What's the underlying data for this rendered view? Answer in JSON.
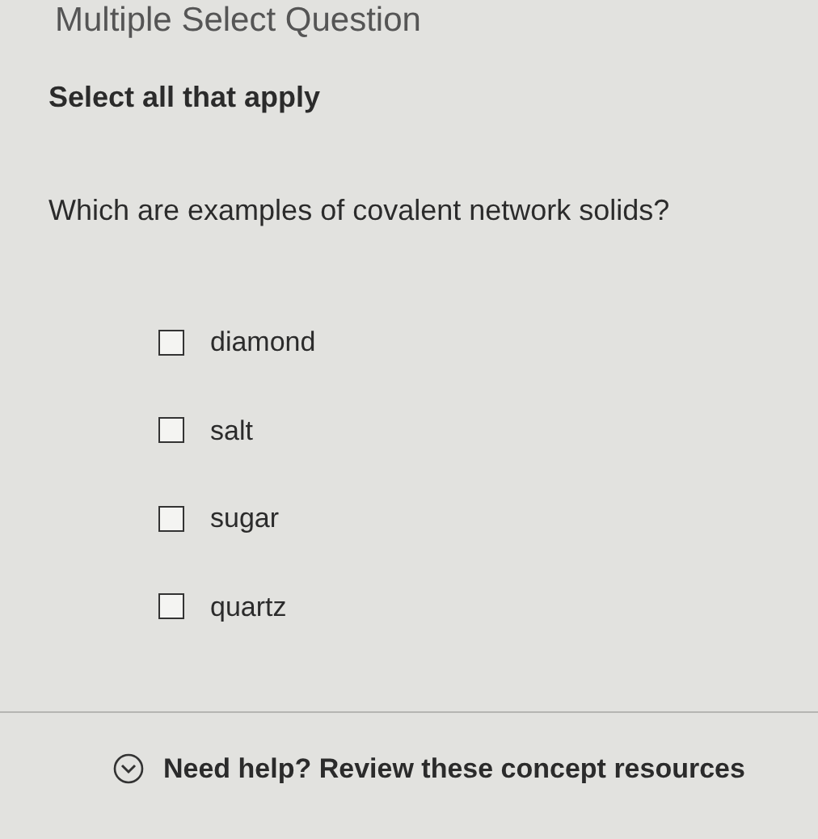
{
  "header": {
    "title": "Multiple Select Question"
  },
  "instruction": "Select all that apply",
  "question": "Which are examples of covalent network solids?",
  "options": [
    {
      "label": "diamond",
      "checked": false
    },
    {
      "label": "salt",
      "checked": false
    },
    {
      "label": "sugar",
      "checked": false
    },
    {
      "label": "quartz",
      "checked": false
    }
  ],
  "help": {
    "label": "Need help? Review these concept resources",
    "expanded": false
  }
}
